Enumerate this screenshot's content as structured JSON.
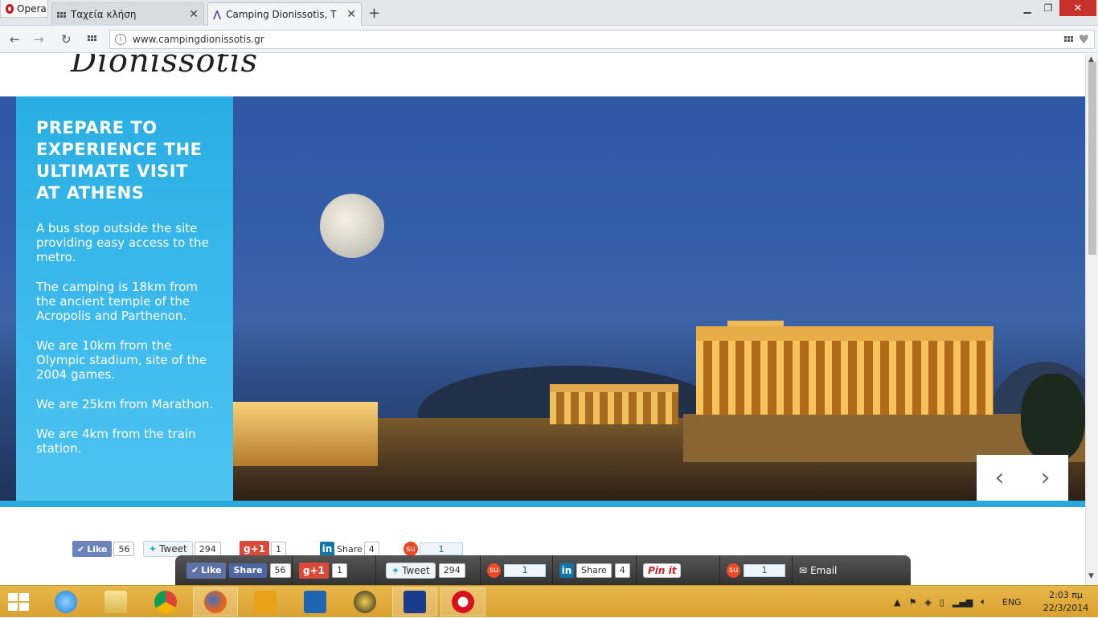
{
  "browser": {
    "menu_label": "Opera",
    "tabs": [
      {
        "title": "Ταχεία κλήση"
      },
      {
        "title": "Camping Dionissotis, The"
      }
    ],
    "url": "www.campingdionissotis.gr"
  },
  "site": {
    "logo_text": "Dionissotis",
    "hero": {
      "title": "PREPARE TO EXPERIENCE THE ULTIMATE VISIT AT ATHENS",
      "paragraphs": [
        "A bus stop outside the site providing easy access to the metro.",
        "The camping is 18km from the ancient temple of the Acropolis and Parthenon.",
        "We are 10km from the Olympic stadium, site of the 2004 games.",
        "We are 25km from Marathon.",
        "We are 4km from the train station."
      ]
    },
    "share_row": {
      "like_label": "Like",
      "like_count": "56",
      "tweet_label": "Tweet",
      "tweet_count": "294",
      "gplus_label": "g+1",
      "gplus_count": "1",
      "linkedin_label": "Share",
      "linkedin_count": "4",
      "stumble_count": "1"
    },
    "floating_bar": {
      "like_label": "Like",
      "share_label": "Share",
      "fb_count": "56",
      "gplus_label": "g+1",
      "gplus_count": "1",
      "tweet_label": "Tweet",
      "tweet_count": "294",
      "stumble_count": "1",
      "linkedin_label": "Share",
      "linkedin_count": "4",
      "pinit_label": "Pin it",
      "stumble2_count": "1",
      "email_label": "Email"
    }
  },
  "taskbar": {
    "language": "ENG",
    "time": "2:03 πμ",
    "date": "22/3/2014"
  },
  "colors": {
    "panel_blue": "#29aee3",
    "accent_bar": "#29a9dd",
    "taskbar": "#dfa93a"
  }
}
